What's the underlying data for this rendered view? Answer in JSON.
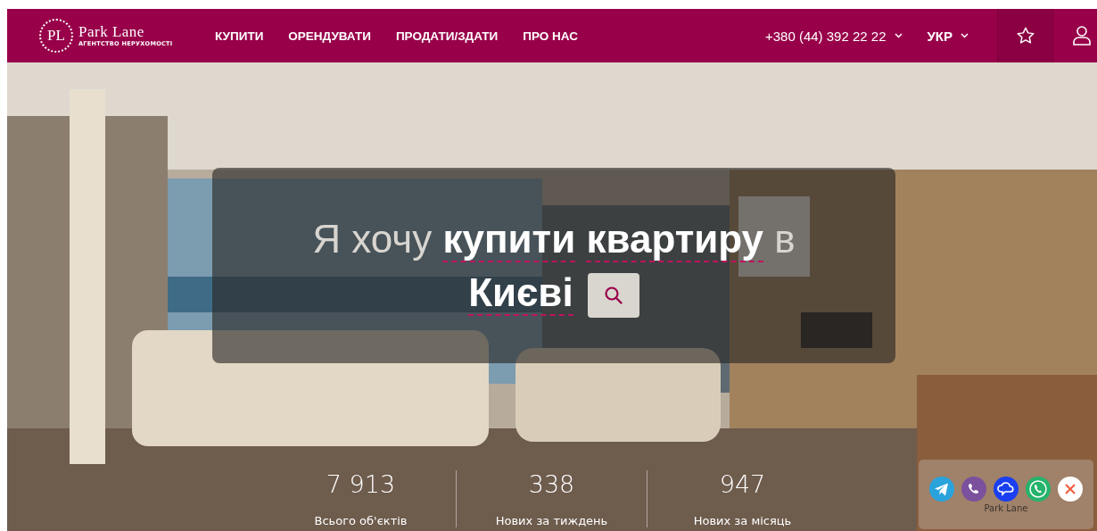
{
  "header": {
    "logo": {
      "monogram": "PL",
      "name": "Park Lane",
      "tagline": "АГЕНТСТВО НЕРУХОМОСТІ"
    },
    "nav": [
      {
        "label": "КУПИТИ"
      },
      {
        "label": "ОРЕНДУВАТИ"
      },
      {
        "label": "ПРОДАТИ/ЗДАТИ"
      },
      {
        "label": "ПРО НАС"
      }
    ],
    "phone": "+380 (44) 392 22 22",
    "language": "УКР"
  },
  "hero": {
    "kind": "picture",
    "phrase": [
      {
        "text": "Я хочу",
        "kind": "plain"
      },
      {
        "text": "купити",
        "kind": "choice"
      },
      {
        "text": "квартиру",
        "kind": "choice"
      },
      {
        "text": "в",
        "kind": "plain"
      },
      {
        "text": "Києві",
        "kind": "choice"
      }
    ],
    "stats": [
      {
        "value": "7 913",
        "label": "Всього об'єктів"
      },
      {
        "value": "338",
        "label": "Нових за тиждень"
      },
      {
        "value": "947",
        "label": "Нових за місяць"
      }
    ]
  },
  "chat_widget": {
    "caption": "Park Lane"
  }
}
